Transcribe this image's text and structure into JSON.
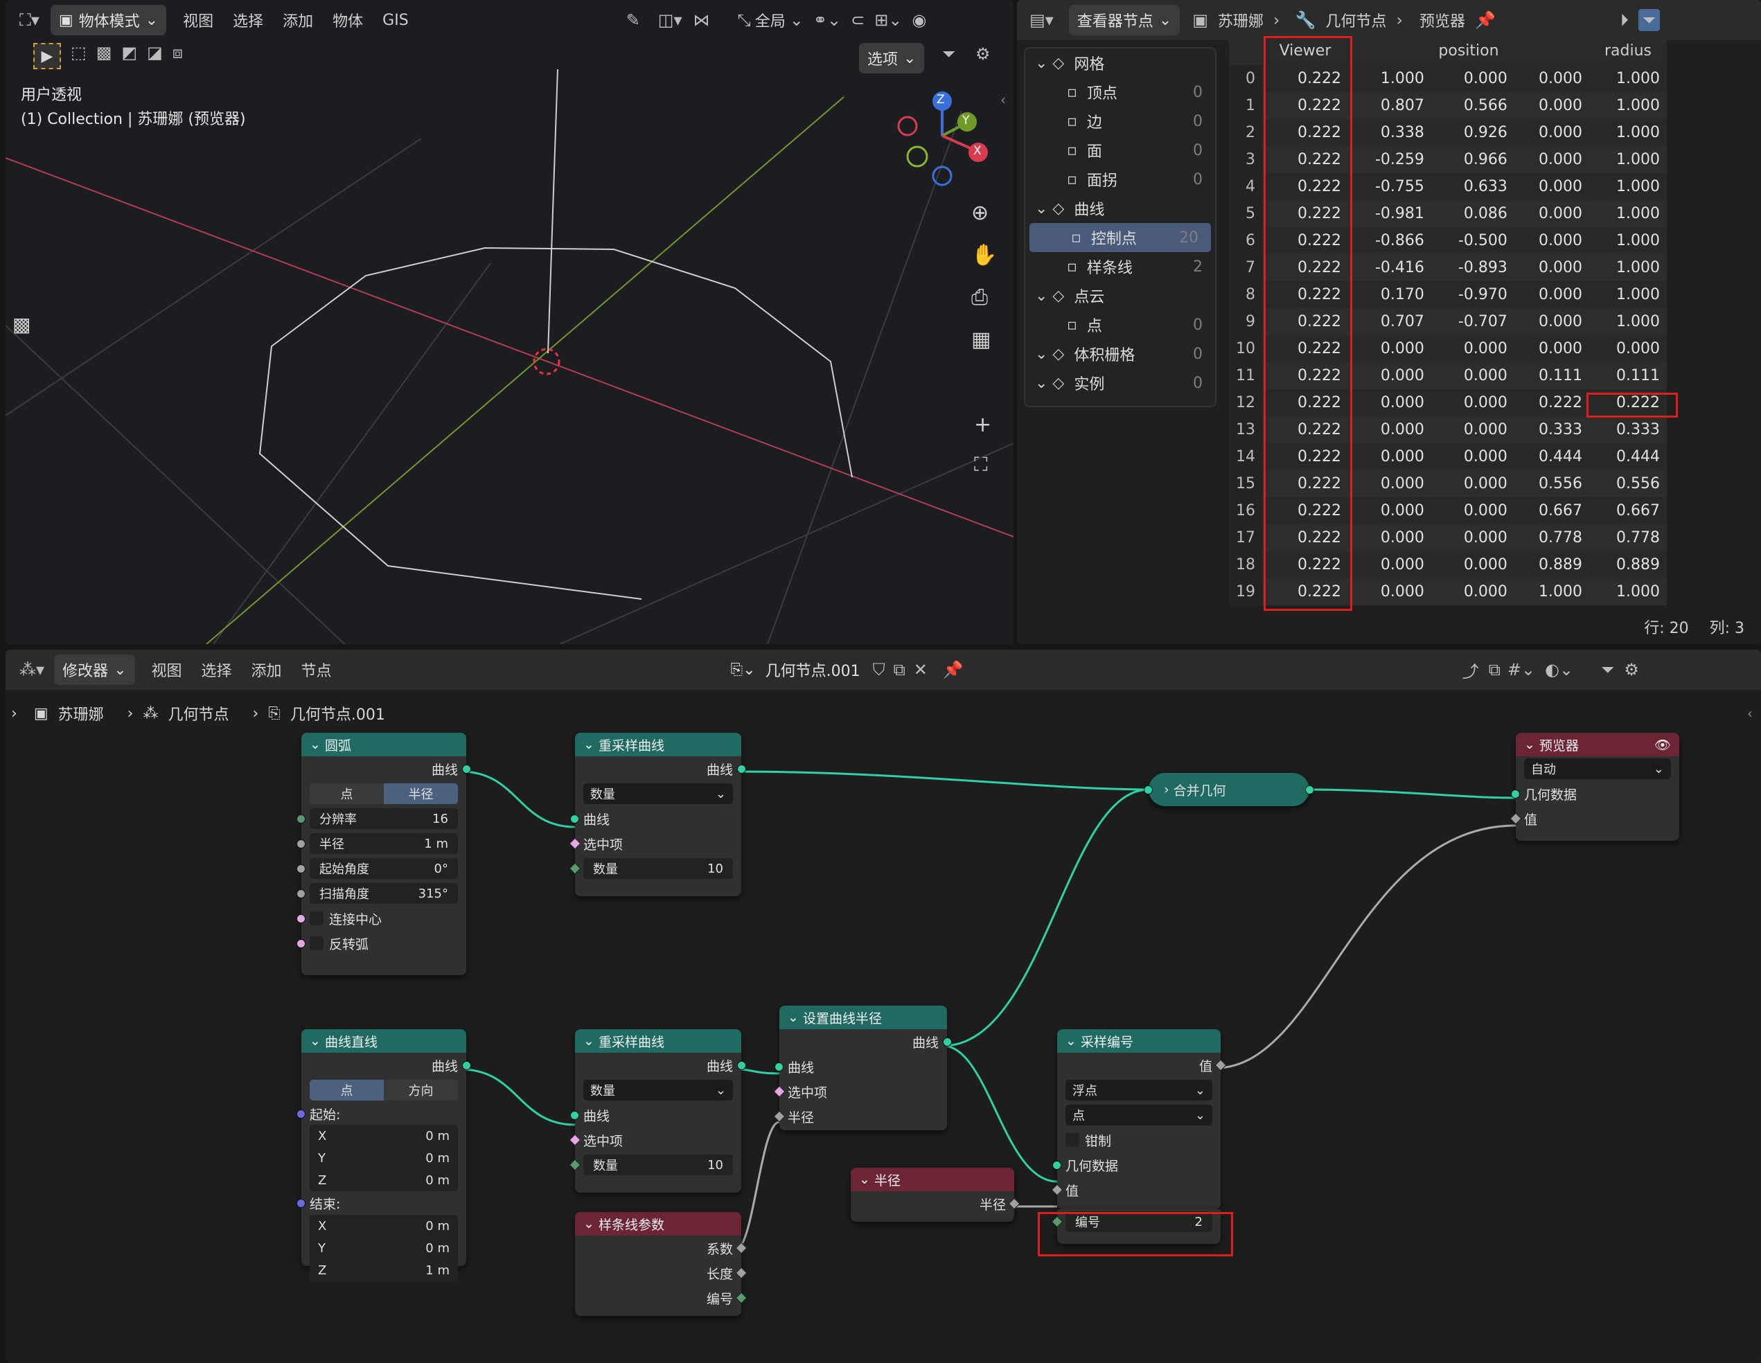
{
  "colors": {
    "teal_header": "#1f6b62",
    "red_header": "#6b2535",
    "link_green": "#2fd0a4",
    "link_gray": "#aaaaaa",
    "highlight": "#e01c1c"
  },
  "viewport": {
    "menu": {
      "mode": "物体模式",
      "items": [
        "视图",
        "选择",
        "添加",
        "物体",
        "GIS"
      ],
      "orientation": "全局"
    },
    "options_label": "选项",
    "overlay_title": "用户透视",
    "overlay_collection": "(1) Collection | 苏珊娜 (预览器)",
    "gizmo": {
      "z": "Z",
      "y": "Y",
      "x": "X"
    },
    "icons": [
      "select-box-icon",
      "zoom-icon",
      "hand-icon",
      "camera-icon",
      "grid-icon",
      "plus-icon",
      "frame-icon"
    ]
  },
  "spreadsheet": {
    "header": {
      "editor": "查看器节点",
      "object": "苏珊娜",
      "modifier": "几何节点",
      "viewer": "预览器"
    },
    "outline": [
      {
        "label": "网格",
        "count": "",
        "level": 0,
        "icon": "mesh-icon"
      },
      {
        "label": "顶点",
        "count": "0",
        "level": 1,
        "icon": "vertex-icon"
      },
      {
        "label": "边",
        "count": "0",
        "level": 1,
        "icon": "edge-icon"
      },
      {
        "label": "面",
        "count": "0",
        "level": 1,
        "icon": "face-icon"
      },
      {
        "label": "面拐",
        "count": "0",
        "level": 1,
        "icon": "corner-icon"
      },
      {
        "label": "曲线",
        "count": "",
        "level": 0,
        "icon": "curve-icon"
      },
      {
        "label": "控制点",
        "count": "20",
        "level": 1,
        "icon": "control-point-icon",
        "selected": true
      },
      {
        "label": "样条线",
        "count": "2",
        "level": 1,
        "icon": "spline-icon"
      },
      {
        "label": "点云",
        "count": "",
        "level": 0,
        "icon": "pointcloud-icon"
      },
      {
        "label": "点",
        "count": "0",
        "level": 1,
        "icon": "point-icon"
      },
      {
        "label": "体积栅格",
        "count": "0",
        "level": 0,
        "icon": "volume-icon"
      },
      {
        "label": "实例",
        "count": "0",
        "level": 0,
        "icon": "instance-icon"
      }
    ],
    "columns": [
      "Viewer",
      "position",
      "radius"
    ],
    "rows": [
      [
        "0",
        "0.222",
        "1.000",
        "0.000",
        "0.000",
        "1.000"
      ],
      [
        "1",
        "0.222",
        "0.807",
        "0.566",
        "0.000",
        "1.000"
      ],
      [
        "2",
        "0.222",
        "0.338",
        "0.926",
        "0.000",
        "1.000"
      ],
      [
        "3",
        "0.222",
        "-0.259",
        "0.966",
        "0.000",
        "1.000"
      ],
      [
        "4",
        "0.222",
        "-0.755",
        "0.633",
        "0.000",
        "1.000"
      ],
      [
        "5",
        "0.222",
        "-0.981",
        "0.086",
        "0.000",
        "1.000"
      ],
      [
        "6",
        "0.222",
        "-0.866",
        "-0.500",
        "0.000",
        "1.000"
      ],
      [
        "7",
        "0.222",
        "-0.416",
        "-0.893",
        "0.000",
        "1.000"
      ],
      [
        "8",
        "0.222",
        "0.170",
        "-0.970",
        "0.000",
        "1.000"
      ],
      [
        "9",
        "0.222",
        "0.707",
        "-0.707",
        "0.000",
        "1.000"
      ],
      [
        "10",
        "0.222",
        "0.000",
        "0.000",
        "0.000",
        "0.000"
      ],
      [
        "11",
        "0.222",
        "0.000",
        "0.000",
        "0.111",
        "0.111"
      ],
      [
        "12",
        "0.222",
        "0.000",
        "0.000",
        "0.222",
        "0.222"
      ],
      [
        "13",
        "0.222",
        "0.000",
        "0.000",
        "0.333",
        "0.333"
      ],
      [
        "14",
        "0.222",
        "0.000",
        "0.000",
        "0.444",
        "0.444"
      ],
      [
        "15",
        "0.222",
        "0.000",
        "0.000",
        "0.556",
        "0.556"
      ],
      [
        "16",
        "0.222",
        "0.000",
        "0.000",
        "0.667",
        "0.667"
      ],
      [
        "17",
        "0.222",
        "0.000",
        "0.000",
        "0.778",
        "0.778"
      ],
      [
        "18",
        "0.222",
        "0.000",
        "0.000",
        "0.889",
        "0.889"
      ],
      [
        "19",
        "0.222",
        "0.000",
        "0.000",
        "1.000",
        "1.000"
      ]
    ],
    "footer": {
      "rows": "行: 20",
      "cols": "列: 3"
    }
  },
  "node_editor": {
    "menu": {
      "editor": "修改器",
      "items": [
        "视图",
        "选择",
        "添加",
        "节点"
      ],
      "tree": "几何节点.001"
    },
    "breadcrumb": [
      "苏珊娜",
      "几何节点",
      "几何节点.001"
    ],
    "arc": {
      "title": "圆弧",
      "out": "曲线",
      "seg": [
        "点",
        "半径"
      ],
      "resolution_label": "分辨率",
      "resolution": "16",
      "radius_label": "半径",
      "radius": "1 m",
      "start_label": "起始角度",
      "start": "0°",
      "sweep_label": "扫描角度",
      "sweep": "315°",
      "connect": "连接中心",
      "invert": "反转弧"
    },
    "resample1": {
      "title": "重采样曲线",
      "out": "曲线",
      "mode": "数量",
      "in_curve": "曲线",
      "in_sel": "选中项",
      "count_label": "数量",
      "count": "10"
    },
    "join": {
      "title": "合并几何"
    },
    "viewer": {
      "title": "预览器",
      "mode": "自动",
      "geo": "几何数据",
      "value": "值"
    },
    "line": {
      "title": "曲线直线",
      "out": "曲线",
      "seg": [
        "点",
        "方向"
      ],
      "start": "起始:",
      "end": "结束:",
      "sx": "0 m",
      "sy": "0 m",
      "sz": "0 m",
      "ex": "0 m",
      "ey": "0 m",
      "ez": "1 m",
      "x": "X",
      "y": "Y",
      "z": "Z"
    },
    "resample2": {
      "title": "重采样曲线",
      "out": "曲线",
      "mode": "数量",
      "in_curve": "曲线",
      "in_sel": "选中项",
      "count_label": "数量",
      "count": "10"
    },
    "setradius": {
      "title": "设置曲线半径",
      "out": "曲线",
      "in_curve": "曲线",
      "in_sel": "选中项",
      "in_radius": "半径"
    },
    "splineparam": {
      "title": "样条线参数",
      "factor": "系数",
      "length": "长度",
      "index": "编号"
    },
    "radius": {
      "title": "半径",
      "out": "半径"
    },
    "sampleidx": {
      "title": "采样编号",
      "out": "值",
      "type": "浮点",
      "domain": "点",
      "clamp": "钳制",
      "geo": "几何数据",
      "value": "值",
      "index_label": "编号",
      "index": "2"
    }
  }
}
